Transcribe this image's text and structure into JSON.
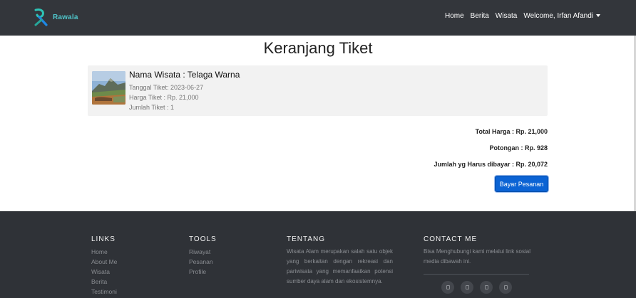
{
  "navbar": {
    "brand": "Rawala",
    "links": [
      "Home",
      "Berita",
      "Wisata"
    ],
    "user_menu": "Welcome, Irfan Afandi"
  },
  "main": {
    "title": "Keranjang Tiket",
    "item": {
      "name": "Nama Wisata : Telaga Warna",
      "date": "Tanggal Tiket: 2023-06-27",
      "price": "Harga Tiket : Rp. 21,000",
      "qty": "Jumlah Tiket : 1"
    },
    "summary": {
      "total": "Total Harga : Rp. 21,000",
      "discount": "Potongan : Rp. 928",
      "to_pay": "Jumlah yg Harus dibayar : Rp. 20,072"
    },
    "pay_button": "Bayar Pesanan"
  },
  "footer": {
    "links_title": "LINKS",
    "links": [
      "Home",
      "About Me",
      "Wisata",
      "Berita",
      "Testimoni"
    ],
    "tools_title": "TOOLS",
    "tools": [
      "Riwayat",
      "Pesanan",
      "Profile"
    ],
    "about_title": "TENTANG",
    "about_text": "Wisata Alam merupakan salah satu objek yang berkaitan dengan rekreasi dan pariwisata yang memanfaatkan potensi sumber daya alam dan ekosistemnya.",
    "contact_title": "CONTACT ME",
    "contact_text": "Bisa Menghubungi kami melalui link sosial media dibawah ini.",
    "socials": [
      "facebook-icon",
      "instagram-icon",
      "twitter-icon",
      "youtube-icon"
    ]
  },
  "colors": {
    "navbar_bg": "#33363b",
    "footer_bg": "#2f3237",
    "brand_accent": "#4fc3c8",
    "button_primary": "#0b63d4"
  }
}
